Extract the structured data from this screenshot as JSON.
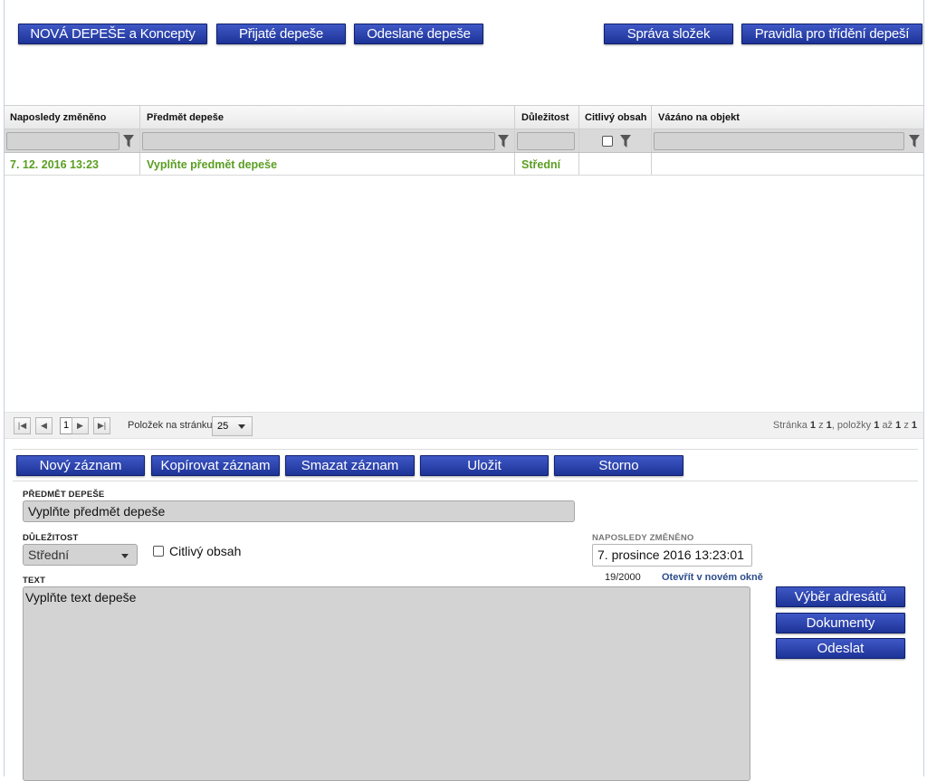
{
  "toolbar": {
    "new_message": "NOVÁ DEPEŠE a Koncepty",
    "received": "Přijaté depeše",
    "sent": "Odeslané depeše",
    "folders": "Správa složek",
    "rules": "Pravidla pro třídění depeší"
  },
  "grid": {
    "columns": [
      "Naposledy změněno",
      "Předmět depeše",
      "Důležitost",
      "Citlivý obsah",
      "Vázáno na objekt"
    ],
    "rows": [
      {
        "modified": "7. 12. 2016 13:23",
        "subject": "Vyplňte předmět depeše",
        "importance": "Střední",
        "sensitive": "",
        "linked": ""
      }
    ]
  },
  "pager": {
    "first_icon": "first-page-icon",
    "prev_icon": "prev-page-icon",
    "next_icon": "next-page-icon",
    "last_icon": "last-page-icon",
    "current_page": "1",
    "per_page_label": "Položek na stránku",
    "per_page_value": "25",
    "summary_page_label": "Stránka",
    "summary_page": "1",
    "summary_of": "z",
    "summary_pages": "1",
    "summary_items_label": ", položky",
    "summary_from": "1",
    "summary_to_label": "až",
    "summary_to": "1",
    "summary_of2": "z",
    "summary_total": "1"
  },
  "actions": {
    "new_record": "Nový záznam",
    "copy_record": "Kopírovat záznam",
    "delete_record": "Smazat záznam",
    "save": "Uložit",
    "cancel": "Storno"
  },
  "form": {
    "subject_label": "Předmět depeše",
    "subject_value": "Vyplňte předmět depeše",
    "importance_label": "Důležitost",
    "importance_value": "Střední",
    "sensitive_label": "Citlivý obsah",
    "modified_label": "Naposledy změněno",
    "modified_value": "7. prosince 2016 13:23:01",
    "text_label": "Text",
    "text_counter": "19/2000",
    "open_new_window": "Otevřít v novém okně",
    "text_value": "Vyplňte text depeše"
  },
  "side_actions": {
    "recipients": "Výběr adresátů",
    "documents": "Dokumenty",
    "send": "Odeslat"
  },
  "colors": {
    "button_top": "#3f58c6",
    "button_bottom": "#1d3397",
    "row_text": "#5a9e22",
    "field_bg": "#d3d3d3",
    "link": "#2b4c8c"
  }
}
